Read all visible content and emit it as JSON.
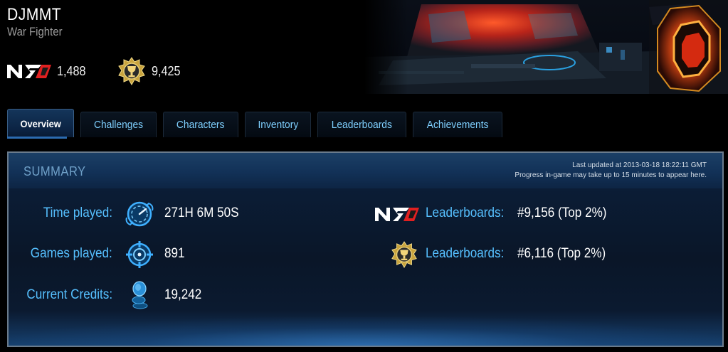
{
  "profile": {
    "username": "DJMMT",
    "rank_title": "War Fighter",
    "n7_rating": "1,488",
    "challenge_points": "9,425"
  },
  "tabs": [
    {
      "label": "Overview",
      "active": true
    },
    {
      "label": "Challenges",
      "active": false
    },
    {
      "label": "Characters",
      "active": false
    },
    {
      "label": "Inventory",
      "active": false
    },
    {
      "label": "Leaderboards",
      "active": false
    },
    {
      "label": "Achievements",
      "active": false
    }
  ],
  "summary": {
    "title": "SUMMARY",
    "last_updated": "Last updated at 2013-03-18 18:22:11 GMT",
    "progress_note": "Progress in-game may take up to 15 minutes to appear here.",
    "stats": [
      {
        "label": "Time played:",
        "value": "271H 6M 50S",
        "icon": "clock-icon"
      },
      {
        "label": "Games played:",
        "value": "891",
        "icon": "crosshair-icon"
      },
      {
        "label": "Current Credits:",
        "value": "19,242",
        "icon": "credits-icon"
      }
    ],
    "leaderboards": [
      {
        "label": "Leaderboards:",
        "value": "#9,156 (Top 2%)",
        "icon": "n7-icon"
      },
      {
        "label": "Leaderboards:",
        "value": "#6,116 (Top 2%)",
        "icon": "challenge-medal-icon"
      }
    ]
  },
  "colors": {
    "accent_blue": "#56c0ff",
    "tab_text": "#7fd0ff",
    "n7_red": "#e02020",
    "medal_gold": "#d4b24a"
  }
}
